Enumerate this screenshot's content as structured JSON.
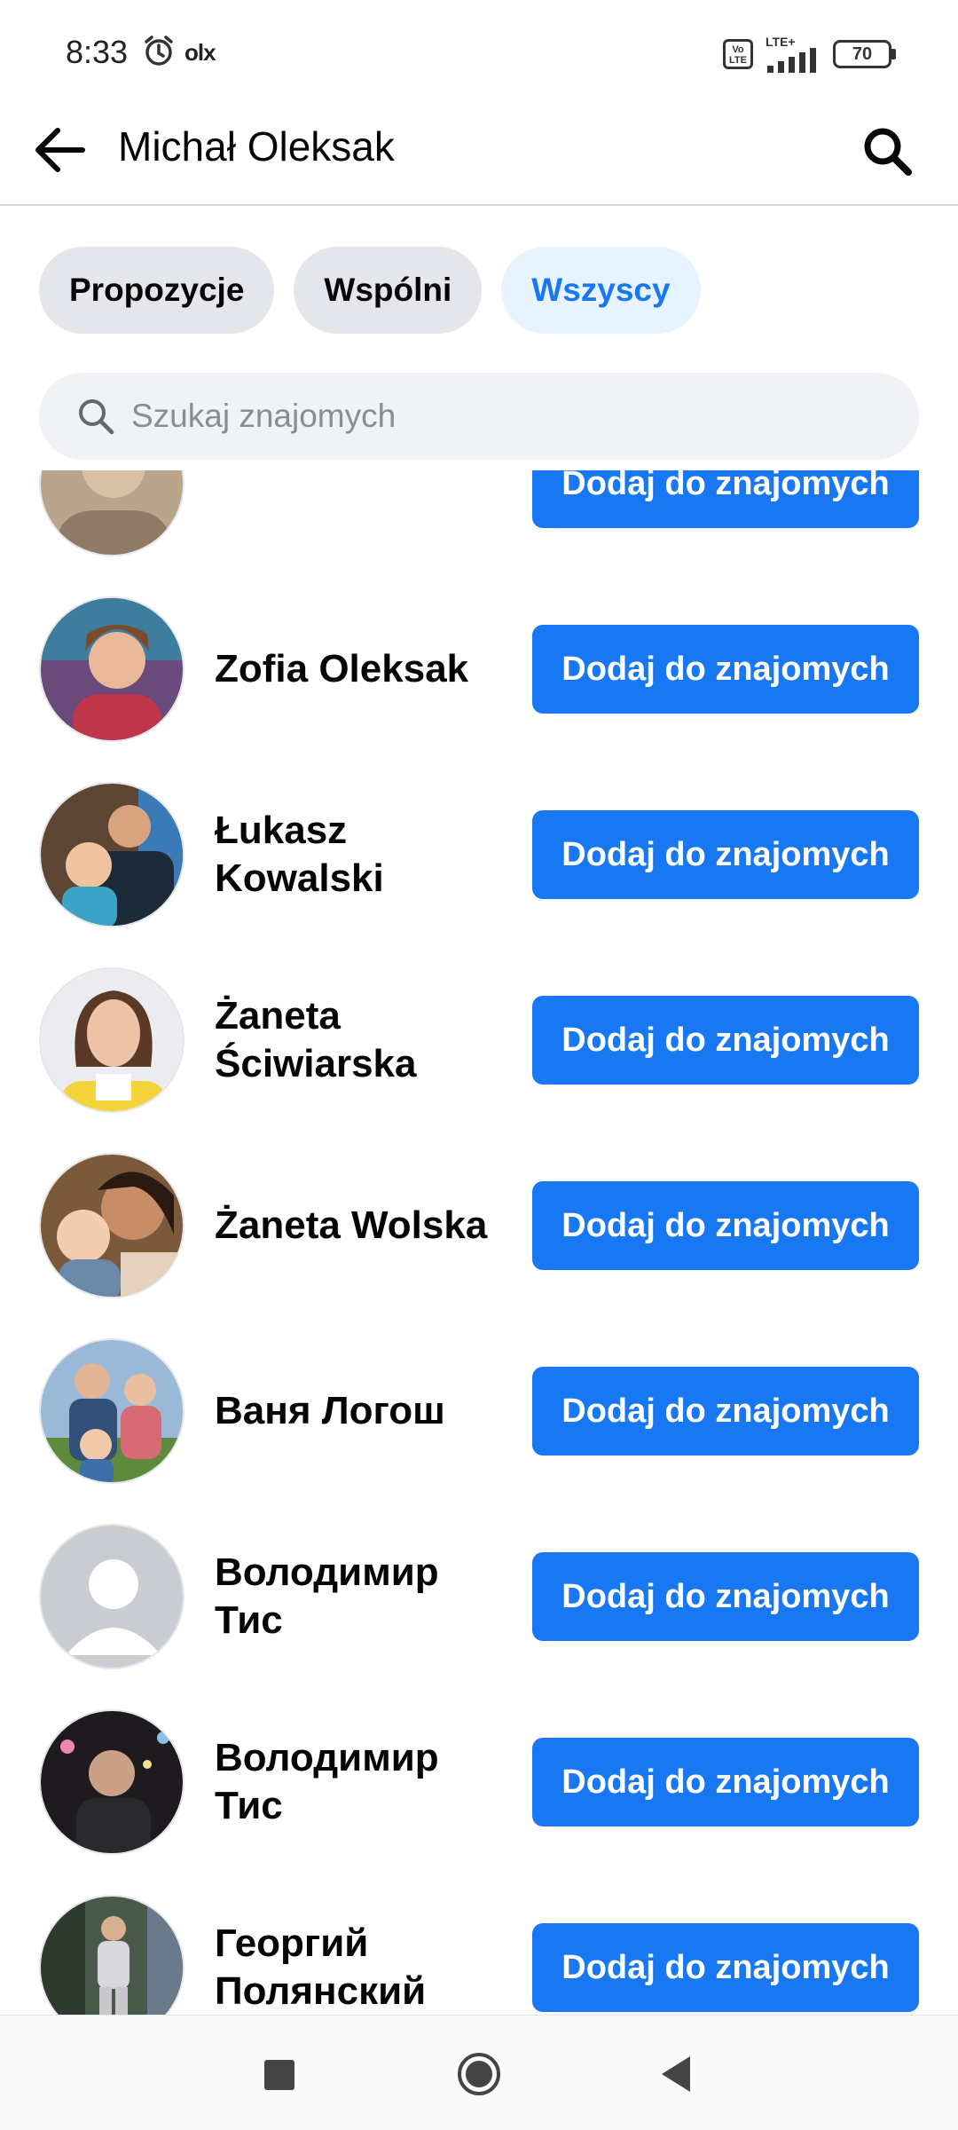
{
  "status_bar": {
    "time": "8:33",
    "olx_label": "olx",
    "volte_label": "Vo LTE",
    "network_label": "LTE+",
    "battery_level": "70"
  },
  "header": {
    "title": "Michał Oleksak"
  },
  "tabs": [
    {
      "label": "Propozycje",
      "active": false
    },
    {
      "label": "Wspólni",
      "active": false
    },
    {
      "label": "Wszyscy",
      "active": true
    }
  ],
  "search": {
    "placeholder": "Szukaj znajomych",
    "value": ""
  },
  "friends": [
    {
      "name": "",
      "button_label": "Dodaj do znajomych",
      "avatar": "photo"
    },
    {
      "name": "Zofia Oleksak",
      "button_label": "Dodaj do znajomych",
      "avatar": "photo"
    },
    {
      "name": "Łukasz Kowalski",
      "button_label": "Dodaj do znajomych",
      "avatar": "photo"
    },
    {
      "name": "Żaneta Ściwiarska",
      "button_label": "Dodaj do znajomych",
      "avatar": "photo"
    },
    {
      "name": "Żaneta Wolska",
      "button_label": "Dodaj do znajomych",
      "avatar": "photo"
    },
    {
      "name": "Ваня Логош",
      "button_label": "Dodaj do znajomych",
      "avatar": "photo"
    },
    {
      "name": "Володимир Тис",
      "button_label": "Dodaj do znajomych",
      "avatar": "default"
    },
    {
      "name": "Володимир Тис",
      "button_label": "Dodaj do znajomych",
      "avatar": "photo"
    },
    {
      "name": "Георгий Полянский",
      "button_label": "Dodaj do znajomych",
      "avatar": "photo"
    }
  ],
  "colors": {
    "accent": "#1877f2",
    "active_tab_bg": "#e7f3ff",
    "tab_bg": "#e4e6eb",
    "search_bg": "#f0f2f5"
  }
}
